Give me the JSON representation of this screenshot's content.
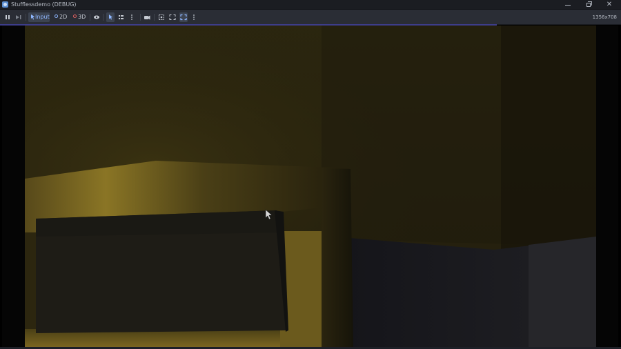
{
  "window": {
    "title": "Stufflessdemo (DEBUG)"
  },
  "toolbar": {
    "input_label": "Input",
    "view2d_label": "2D",
    "view3d_label": "3D",
    "resolution": "1356x708"
  },
  "icons": {
    "pause": "pause-icon",
    "step": "step-forward-icon",
    "eye": "eye-icon",
    "select": "select-cursor-icon",
    "list": "list-icon",
    "camera": "camera-icon",
    "fit": "fit-view-icon",
    "fullscreen": "fullscreen-icon",
    "more": "more-vertical-icon"
  },
  "colors": {
    "accent": "#8fb7ff",
    "dot2d": "#8fb7ff",
    "dot3d": "#e06161"
  }
}
